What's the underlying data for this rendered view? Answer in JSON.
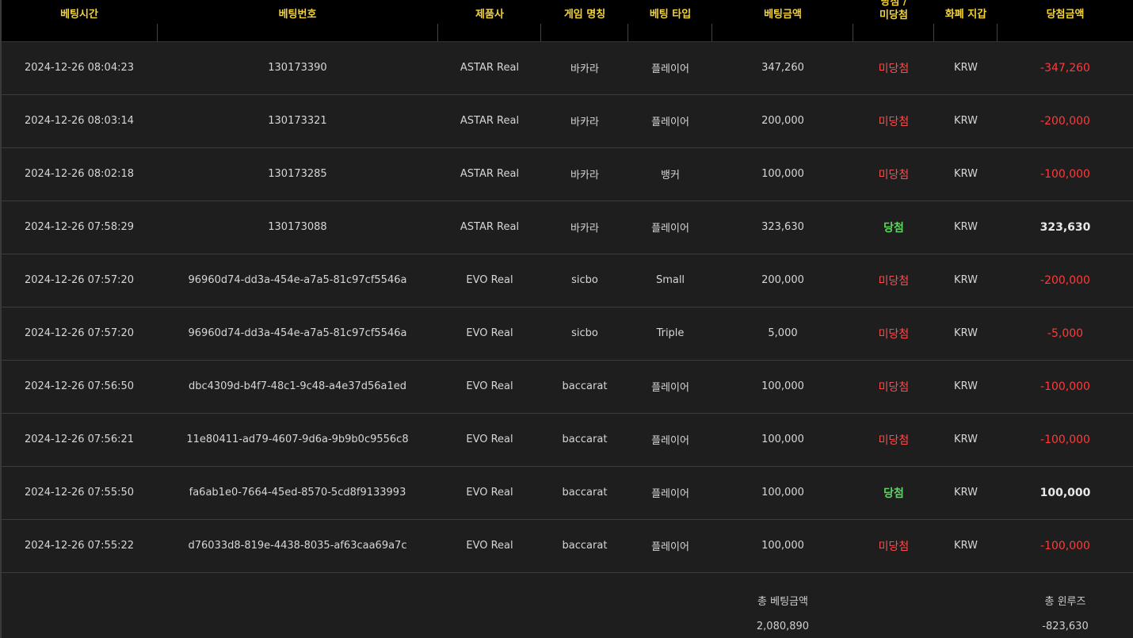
{
  "colors": {
    "header_text": "#f5d431",
    "lose": "#ff4b4b",
    "win": "#5cd65c",
    "row_bg": "#1e1e1f",
    "header_bg": "#000000"
  },
  "columns": [
    "베팅시간",
    "베팅번호",
    "제품사",
    "게임 명칭",
    "베팅 타입",
    "베팅금액",
    "당첨 /",
    "미당첨",
    "화폐 지갑",
    "당첨금액"
  ],
  "rows": [
    {
      "time": "2024-12-26 08:04:23",
      "bet_id": "130173390",
      "provider": "ASTAR Real",
      "game": "바카라",
      "bet_type": "플레이어",
      "amount": "347,260",
      "result": "미당첨",
      "result_status": "lose",
      "currency": "KRW",
      "win_amount": "-347,260"
    },
    {
      "time": "2024-12-26 08:03:14",
      "bet_id": "130173321",
      "provider": "ASTAR Real",
      "game": "바카라",
      "bet_type": "플레이어",
      "amount": "200,000",
      "result": "미당첨",
      "result_status": "lose",
      "currency": "KRW",
      "win_amount": "-200,000"
    },
    {
      "time": "2024-12-26 08:02:18",
      "bet_id": "130173285",
      "provider": "ASTAR Real",
      "game": "바카라",
      "bet_type": "뱅커",
      "amount": "100,000",
      "result": "미당첨",
      "result_status": "lose",
      "currency": "KRW",
      "win_amount": "-100,000"
    },
    {
      "time": "2024-12-26 07:58:29",
      "bet_id": "130173088",
      "provider": "ASTAR Real",
      "game": "바카라",
      "bet_type": "플레이어",
      "amount": "323,630",
      "result": "당첨",
      "result_status": "win",
      "currency": "KRW",
      "win_amount": "323,630"
    },
    {
      "time": "2024-12-26 07:57:20",
      "bet_id": "96960d74-dd3a-454e-a7a5-81c97cf5546a",
      "provider": "EVO Real",
      "game": "sicbo",
      "bet_type": "Small",
      "amount": "200,000",
      "result": "미당첨",
      "result_status": "lose",
      "currency": "KRW",
      "win_amount": "-200,000"
    },
    {
      "time": "2024-12-26 07:57:20",
      "bet_id": "96960d74-dd3a-454e-a7a5-81c97cf5546a",
      "provider": "EVO Real",
      "game": "sicbo",
      "bet_type": "Triple",
      "amount": "5,000",
      "result": "미당첨",
      "result_status": "lose",
      "currency": "KRW",
      "win_amount": "-5,000"
    },
    {
      "time": "2024-12-26 07:56:50",
      "bet_id": "dbc4309d-b4f7-48c1-9c48-a4e37d56a1ed",
      "provider": "EVO Real",
      "game": "baccarat",
      "bet_type": "플레이어",
      "amount": "100,000",
      "result": "미당첨",
      "result_status": "lose",
      "currency": "KRW",
      "win_amount": "-100,000"
    },
    {
      "time": "2024-12-26 07:56:21",
      "bet_id": "11e80411-ad79-4607-9d6a-9b9b0c9556c8",
      "provider": "EVO Real",
      "game": "baccarat",
      "bet_type": "플레이어",
      "amount": "100,000",
      "result": "미당첨",
      "result_status": "lose",
      "currency": "KRW",
      "win_amount": "-100,000"
    },
    {
      "time": "2024-12-26 07:55:50",
      "bet_id": "fa6ab1e0-7664-45ed-8570-5cd8f9133993",
      "provider": "EVO Real",
      "game": "baccarat",
      "bet_type": "플레이어",
      "amount": "100,000",
      "result": "당첨",
      "result_status": "win",
      "currency": "KRW",
      "win_amount": "100,000"
    },
    {
      "time": "2024-12-26 07:55:22",
      "bet_id": "d76033d8-819e-4438-8035-af63caa69a7c",
      "provider": "EVO Real",
      "game": "baccarat",
      "bet_type": "플레이어",
      "amount": "100,000",
      "result": "미당첨",
      "result_status": "lose",
      "currency": "KRW",
      "win_amount": "-100,000"
    }
  ],
  "summary": {
    "total_bet_label": "총 베팅금액",
    "total_bet_value": "2,080,890",
    "total_winloss_label": "총 윈루즈",
    "total_winloss_value": "-823,630"
  }
}
